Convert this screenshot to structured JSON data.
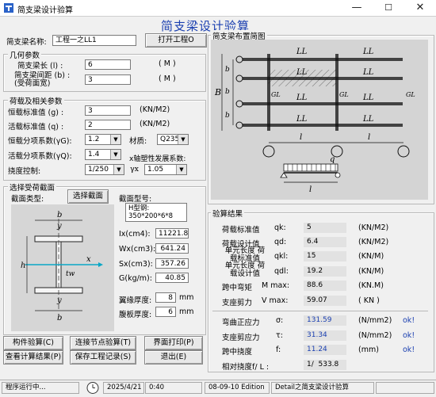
{
  "window": {
    "title": "简支梁设计验算",
    "minimize": "—",
    "maximize": "☐",
    "close": "✕"
  },
  "heading": "简支梁设计验算",
  "beam_name": {
    "label": "简支梁名称:",
    "value": "工程一之LL1",
    "open_button": "打开工程O"
  },
  "geometry": {
    "title": "几何参数",
    "span_label": "简支梁长 (l) :",
    "span_value": "6",
    "span_unit": "( M )",
    "spacing_label_1": "简支梁间距 (b) :",
    "spacing_label_2": "(受荷面宽)",
    "spacing_value": "3",
    "spacing_unit": "( M )"
  },
  "loads": {
    "title": "荷载及相关参数",
    "dead_label": "恒载标准值 (g) :",
    "dead_value": "3",
    "dead_unit": "(KN/M2)",
    "live_label": "活载标准值 (q) :",
    "live_value": "2",
    "live_unit": "(KN/M2)",
    "dead_factor_label": "恒载分项系数(γG):",
    "dead_factor_value": "1.2",
    "material_label": "材质:",
    "material_value": "Q235",
    "live_factor_label": "活载分项系数(γQ):",
    "live_factor_value": "1.4",
    "plastic_label": "x轴塑性发展系数:",
    "gamma_label": "γx",
    "gamma_value": "1.05",
    "deflection_label": "挠度控制:",
    "deflection_value": "1/250"
  },
  "section": {
    "title": "选择受荷截面",
    "type_label": "截面类型:",
    "select_button": "选择截面",
    "model_label": "截面型号:",
    "model_value": "H型钢: 350*200*6*8",
    "ix_label": "Ix(cm4):",
    "ix_value": "11221.81",
    "wx_label": "Wx(cm3):",
    "wx_value": "641.24",
    "sx_label": "Sx(cm3):",
    "sx_value": "357.26",
    "g_label": "G(kg/m):",
    "g_value": "40.85",
    "flange_label": "翼缘厚度:",
    "flange_value": "8",
    "flange_unit": "mm",
    "web_label": "腹板厚度:",
    "web_value": "6",
    "web_unit": "mm",
    "dim_b": "b",
    "dim_h": "h",
    "dim_y": "y",
    "dim_x": "x",
    "dim_tw": "tw"
  },
  "layout_diagram": {
    "title": "简支梁布置简图",
    "beam_label": "LL",
    "span_label": "l",
    "width_label": "b",
    "total_width_label": "B",
    "girder_label": "GL",
    "load_label": "q"
  },
  "results": {
    "title": "验算结果",
    "rows": [
      {
        "label": "荷载标准值",
        "symbol": "qk:",
        "value": "5",
        "unit": "(KN/M2)"
      },
      {
        "label": "荷载设计值",
        "symbol": "qd:",
        "value": "6.4",
        "unit": "(KN/M2)"
      },
      {
        "label": "单元长度 荷载标准值",
        "symbol": "qkl:",
        "value": "15",
        "unit": "(KN/M)"
      },
      {
        "label": "单元长度 荷载设计值",
        "symbol": "qdl:",
        "value": "19.2",
        "unit": "(KN/M)"
      },
      {
        "label": "跨中弯矩",
        "symbol": "M max:",
        "value": "88.6",
        "unit": "(KN.M)"
      },
      {
        "label": "支座剪力",
        "symbol": "V max:",
        "value": "59.07",
        "unit": "( KN )"
      }
    ],
    "checks": [
      {
        "label": "弯曲正应力",
        "symbol": "σ:",
        "value": "131.59",
        "unit": "(N/mm2)",
        "status": "ok!"
      },
      {
        "label": "支座剪应力",
        "symbol": "τ:",
        "value": "31.34",
        "unit": "(N/mm2)",
        "status": "ok!"
      },
      {
        "label": "跨中挠度",
        "symbol": "f:",
        "value": "11.24",
        "unit": "(mm)",
        "status": "ok!"
      }
    ],
    "ratio_label": "相对挠度f/ L :",
    "ratio_prefix": "1/",
    "ratio_value": "533.8"
  },
  "buttons": {
    "check": "构件验算(C)",
    "connection": "连接节点验算(T)",
    "print": "界面打印(P)",
    "view": "查看计算结果(P)",
    "save": "保存工程记录(S)",
    "exit": "退出(E)"
  },
  "status_bar": {
    "running": "程序运行中...",
    "date": "2025/4/21",
    "time": "0:40",
    "edition": "08-09-10 Edition",
    "detail": "Detail之简支梁设计验算"
  }
}
